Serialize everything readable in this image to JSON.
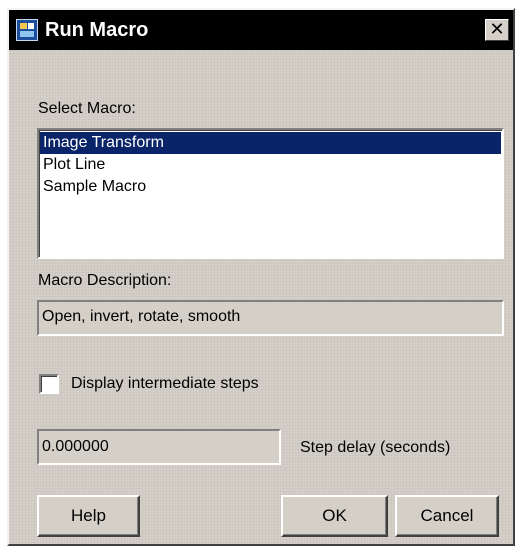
{
  "window": {
    "title": "Run Macro",
    "icon": "macro-app-icon",
    "close_glyph": "✕"
  },
  "select_macro": {
    "label": "Select Macro:",
    "items": [
      {
        "label": "Image Transform",
        "selected": true
      },
      {
        "label": "Plot Line",
        "selected": false
      },
      {
        "label": "Sample Macro",
        "selected": false
      }
    ]
  },
  "description": {
    "label": "Macro Description:",
    "value": "Open, invert, rotate, smooth"
  },
  "display_steps": {
    "label": "Display intermediate steps",
    "checked": false
  },
  "step_delay": {
    "value": "0.000000",
    "label": "Step delay (seconds)"
  },
  "buttons": {
    "help": "Help",
    "ok": "OK",
    "cancel": "Cancel"
  },
  "colors": {
    "dialog_bg": "#d4d0c8",
    "titlebar_bg": "#000000",
    "selection_bg": "#0a246a",
    "selection_text": "#ffffff"
  }
}
